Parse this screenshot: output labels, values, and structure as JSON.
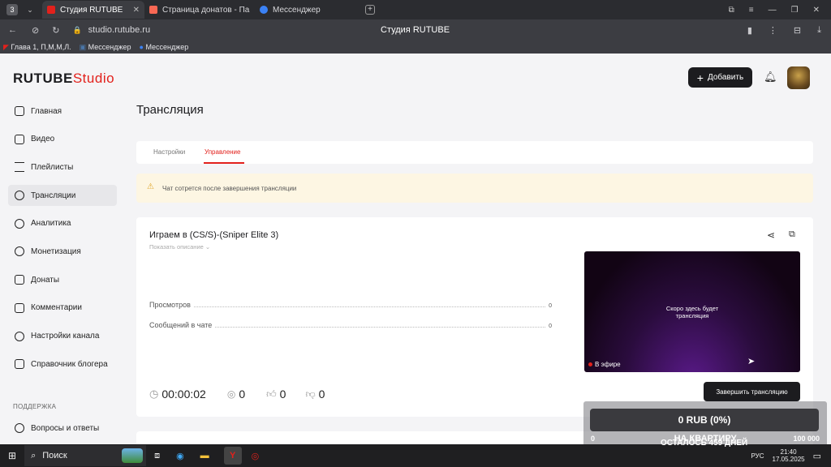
{
  "browser": {
    "tabs": [
      {
        "label": "Студия RUTUBE",
        "active": true,
        "color": "#e2211c"
      },
      {
        "label": "Страница донатов - Пане",
        "active": false,
        "color": "#f96854"
      },
      {
        "label": "Мессенджер",
        "active": false,
        "color": "#3b82f6"
      }
    ],
    "url": "studio.rutube.ru",
    "page_title": "Студия RUTUBE",
    "bookmarks": [
      "Глава 1, П,М,М,Л.",
      "Мессенджер",
      "Мессенджер"
    ]
  },
  "header": {
    "logo_main": "RUTUBE",
    "logo_sub": "Studio",
    "add_label": "Добавить"
  },
  "sidebar": {
    "items": [
      {
        "label": "Главная",
        "icon": "home-icon"
      },
      {
        "label": "Видео",
        "icon": "video-icon"
      },
      {
        "label": "Плейлисты",
        "icon": "playlist-icon"
      },
      {
        "label": "Трансляции",
        "icon": "broadcast-icon",
        "active": true
      },
      {
        "label": "Аналитика",
        "icon": "analytics-icon"
      },
      {
        "label": "Монетизация",
        "icon": "monetization-icon"
      },
      {
        "label": "Донаты",
        "icon": "donate-icon"
      },
      {
        "label": "Комментарии",
        "icon": "comments-icon"
      },
      {
        "label": "Настройки канала",
        "icon": "settings-icon"
      },
      {
        "label": "Справочник блогера",
        "icon": "handbook-icon"
      }
    ],
    "support_heading": "ПОДДЕРЖКА",
    "support_items": [
      {
        "label": "Вопросы и ответы",
        "icon": "help-icon"
      }
    ]
  },
  "main": {
    "title": "Трансляция",
    "tabs": [
      {
        "label": "Настройки",
        "active": false
      },
      {
        "label": "Управление",
        "active": true
      }
    ],
    "notice": "Чат сотрется после завершения трансляции",
    "stream": {
      "title": "Играем в (CS/S)-(Sniper Elite 3)",
      "show_description": "Показать описание",
      "stats": [
        {
          "label": "Просмотров",
          "value": "0"
        },
        {
          "label": "Сообщений в чате",
          "value": "0"
        }
      ],
      "timer": "00:00:02",
      "viewers": "0",
      "likes": "0",
      "dislikes": "0",
      "preview_text_1": "Скоро здесь будет",
      "preview_text_2": "трансляция",
      "live_label": "В эфире",
      "end_button": "Завершить трансляцию"
    }
  },
  "donation": {
    "amount": "0 RUB (0%)",
    "goal_start": "0",
    "goal_end": "100 000",
    "goal_name": "НА КВАРТИРУ",
    "days_left": "ОСТАЛОСЬ 459 ДНЕЙ"
  },
  "taskbar": {
    "search_label": "Поиск",
    "time": "21:40",
    "date": "17.05.2025",
    "lang": "РУС"
  }
}
